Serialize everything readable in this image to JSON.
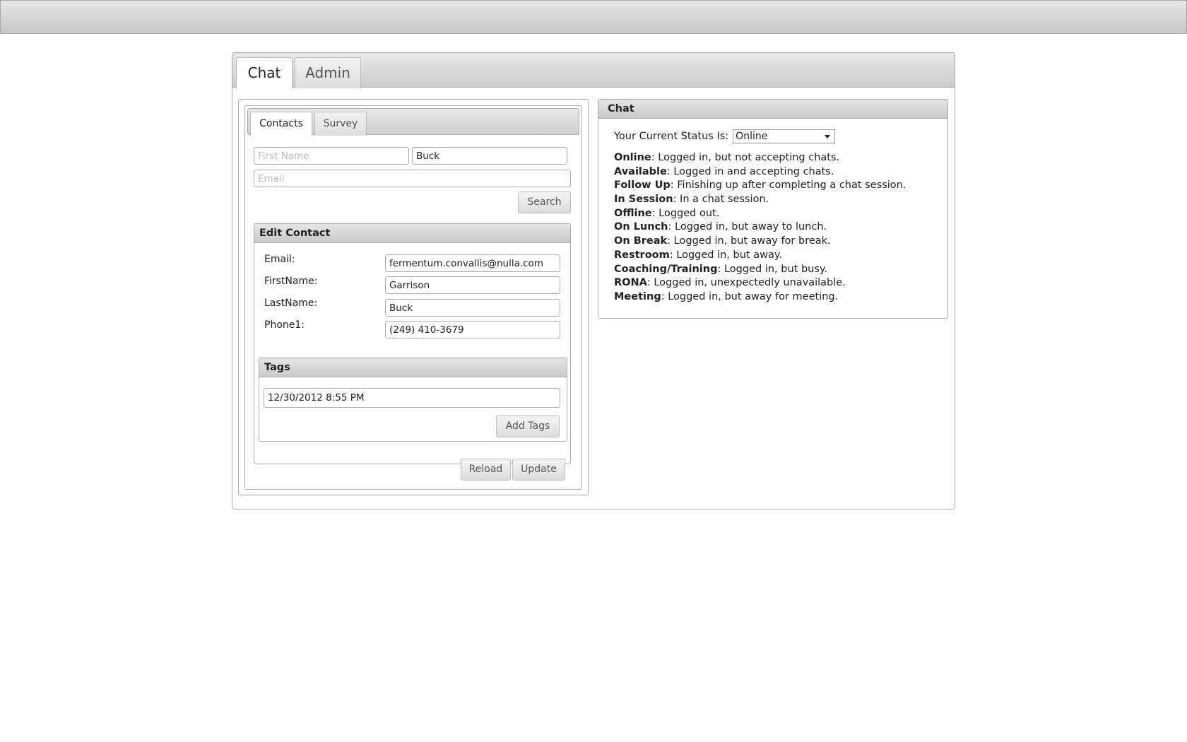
{
  "main_tabs": [
    {
      "label": "Chat",
      "active": true
    },
    {
      "label": "Admin",
      "active": false
    }
  ],
  "contacts_panel": {
    "tabs": [
      {
        "label": "Contacts",
        "active": true
      },
      {
        "label": "Survey",
        "active": false
      }
    ],
    "search": {
      "first_name": {
        "value": "",
        "placeholder": "First Name"
      },
      "last_name": {
        "value": "Buck",
        "placeholder": ""
      },
      "email": {
        "value": "",
        "placeholder": "Email"
      },
      "search_button": "Search"
    },
    "edit_contact": {
      "title": "Edit Contact",
      "fields": [
        {
          "label": "Email:",
          "value": "fermentum.convallis@nulla.com"
        },
        {
          "label": "FirstName:",
          "value": "Garrison"
        },
        {
          "label": "LastName:",
          "value": "Buck"
        },
        {
          "label": "Phone1:",
          "value": "(249) 410-3679"
        }
      ],
      "tags": {
        "title": "Tags",
        "value": "12/30/2012 8:55 PM",
        "add_button": "Add Tags"
      },
      "reload_button": "Reload",
      "update_button": "Update"
    }
  },
  "chat_panel": {
    "title": "Chat",
    "status_label": "Your Current Status Is:",
    "status_value": "Online",
    "statuses": [
      {
        "name": "Online",
        "desc": ": Logged in, but not accepting chats."
      },
      {
        "name": "Available",
        "desc": ": Logged in and accepting chats."
      },
      {
        "name": "Follow Up",
        "desc": ": Finishing up after completing a chat session."
      },
      {
        "name": "In Session",
        "desc": ": In a chat session."
      },
      {
        "name": "Offline",
        "desc": ": Logged out."
      },
      {
        "name": "On Lunch",
        "desc": ": Logged in, but away to lunch."
      },
      {
        "name": "On Break",
        "desc": ": Logged in, but away for break."
      },
      {
        "name": "Restroom",
        "desc": ": Logged in, but away."
      },
      {
        "name": "Coaching/Training",
        "desc": ": Logged in, but busy."
      },
      {
        "name": "RONA",
        "desc": ": Logged in, unexpectedly unavailable."
      },
      {
        "name": "Meeting",
        "desc": ": Logged in, but away for meeting."
      }
    ]
  }
}
